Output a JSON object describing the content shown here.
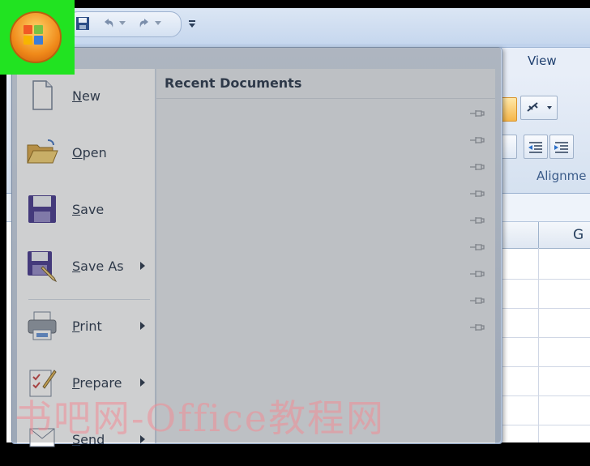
{
  "ribbon": {
    "tab_view": "View",
    "group_alignment": "Alignme"
  },
  "sheet": {
    "column_g": "G"
  },
  "office_menu": {
    "items": [
      {
        "label": "New",
        "has_submenu": false,
        "icon": "new-document-icon"
      },
      {
        "label": "Open",
        "has_submenu": false,
        "icon": "open-folder-icon"
      },
      {
        "label": "Save",
        "has_submenu": false,
        "icon": "save-disk-icon"
      },
      {
        "label": "Save As",
        "has_submenu": true,
        "icon": "save-as-icon"
      },
      {
        "label": "Print",
        "has_submenu": true,
        "icon": "printer-icon"
      },
      {
        "label": "Prepare",
        "has_submenu": true,
        "icon": "prepare-icon"
      },
      {
        "label": "Send",
        "has_submenu": true,
        "icon": "send-icon"
      }
    ],
    "recent_documents_title": "Recent Documents",
    "recent_pin_count": 9
  },
  "highlight_color": "#21e321",
  "watermark": "书吧网-Office教程网"
}
